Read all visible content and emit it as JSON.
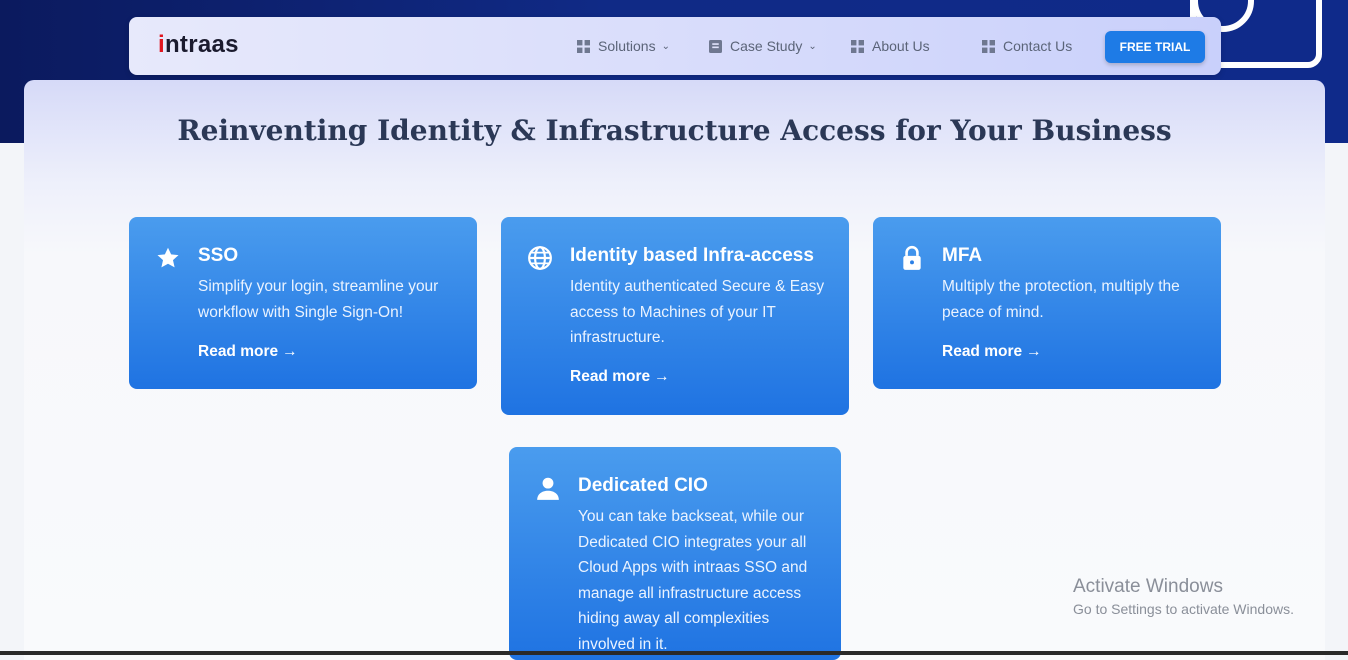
{
  "nav": {
    "logo_prefix": "i",
    "logo_rest": "ntraas",
    "items": [
      {
        "label": "Solutions",
        "dropdown": true,
        "icon": "grid-icon"
      },
      {
        "label": "Case Study",
        "dropdown": true,
        "icon": "document-icon"
      },
      {
        "label": "About Us",
        "dropdown": false,
        "icon": "grid-icon"
      },
      {
        "label": "Contact Us",
        "dropdown": false,
        "icon": "grid-icon"
      }
    ],
    "cta": "FREE TRIAL"
  },
  "main": {
    "headline": "Reinventing Identity & Infrastructure Access for Your Business",
    "cards": [
      {
        "icon": "star-icon",
        "title": "SSO",
        "description": "Simplify your login, streamline your workflow with Single Sign-On!",
        "link": "Read more"
      },
      {
        "icon": "globe-icon",
        "title": "Identity based Infra-access",
        "description": "Identity authenticated Secure & Easy access to Machines of your IT infrastructure.",
        "link": "Read more"
      },
      {
        "icon": "lock-icon",
        "title": "MFA",
        "description": "Multiply the protection, multiply the peace of mind.",
        "link": "Read more"
      },
      {
        "icon": "user-icon",
        "title": "Dedicated CIO",
        "description": "You can take backseat, while our Dedicated CIO integrates your all Cloud Apps with intraas SSO and manage all infrastructure access hiding away all complexities involved in it."
      }
    ]
  },
  "watermark": {
    "line1": "Activate Windows",
    "line2": "Go to Settings to activate Windows."
  },
  "colors": {
    "accent": "#1e7be6",
    "card_top": "#4a9cee",
    "card_bottom": "#1f73e2",
    "hero": "#0f2a8a",
    "heading": "#2b3856"
  }
}
